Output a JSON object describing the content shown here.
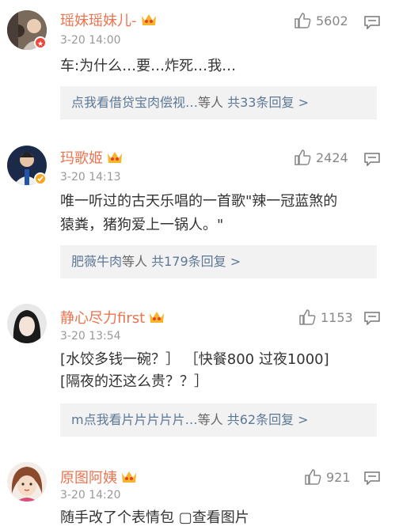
{
  "comments": [
    {
      "username": "瑶妹瑶妹儿-",
      "time": "3-20 14:00",
      "text": "车:为什么…要…炸死…我…",
      "likes": "5602",
      "reply_link": "点我看借贷宝肉偿视…",
      "reply_mid": "等人",
      "reply_count": "共33条回复 >",
      "badge_color": "#f0453b",
      "avatar_icon": "user-avatar"
    },
    {
      "username": "玛歌姬",
      "time": "3-20 14:13",
      "text": "唯一听过的古天乐唱的一首歌\"辣一冠蓝煞的\n猿粪，猪狗爱上一锅人。\"",
      "likes": "2424",
      "reply_link": "肥薇牛肉",
      "reply_mid": "等人",
      "reply_count": "共179条回复 >",
      "badge_color": "#f6a623",
      "avatar_icon": "user-avatar"
    },
    {
      "username": "静心尽力first",
      "time": "3-20 13:54",
      "text": "[水饺多钱一碗？］ ［快餐800 过夜1000]\n[隔夜的还这么贵？？］",
      "likes": "1153",
      "reply_link": "m点我看片片片片片…",
      "reply_mid": "等人",
      "reply_count": "共62条回复 >",
      "avatar_icon": "user-avatar"
    },
    {
      "username": "原图阿姨",
      "time": "3-20 14:20",
      "text": "随手改了个表情包 ▢查看图片",
      "likes": "921",
      "avatar_icon": "user-avatar"
    }
  ],
  "colors": {
    "username": "#eb7350",
    "link": "#5d7895",
    "background_reply": "#f2f2f2"
  }
}
